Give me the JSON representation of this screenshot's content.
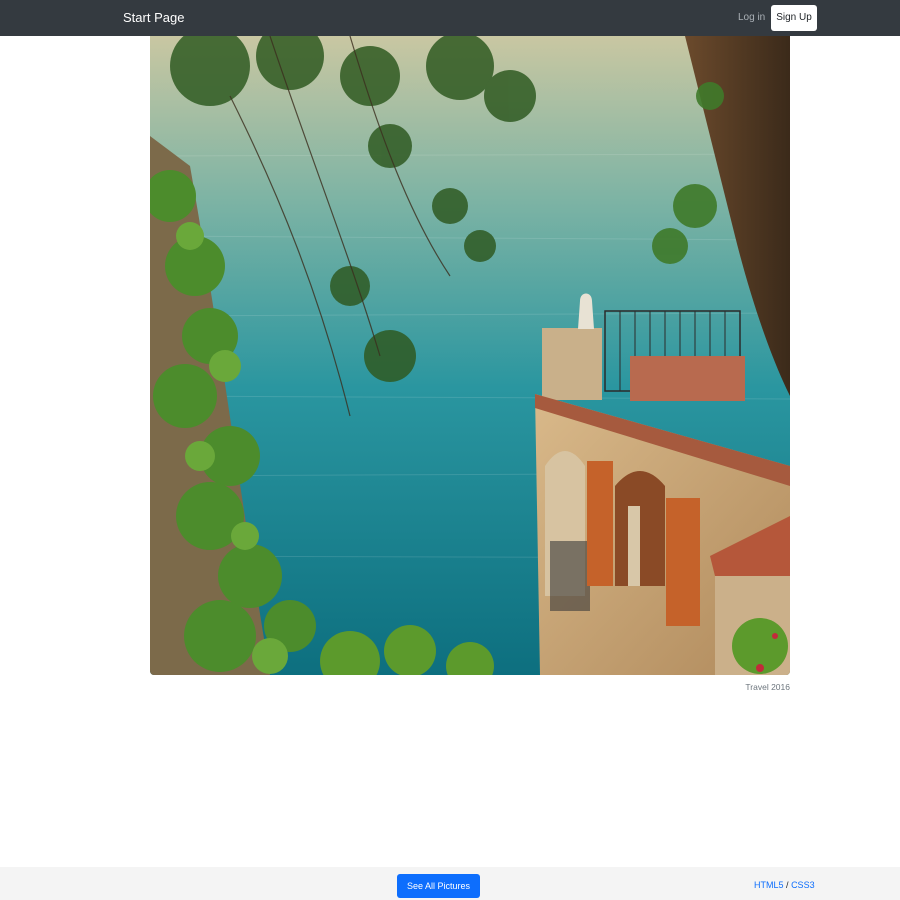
{
  "navbar": {
    "brand": "Start Page",
    "login_label": "Log in",
    "signup_label": "Sign Up",
    "background": "#343a40"
  },
  "photo": {
    "caption": "Travel 2016",
    "description_icon": "photo-seaside-villa"
  },
  "footer": {
    "see_all_label": "See All Pictures",
    "tech_html5": "HTML5",
    "tech_sep": "/",
    "tech_css3": "CSS3"
  },
  "colors": {
    "primary": "#0d6efd",
    "sea": "#1f8a94",
    "foliage": "#3f7a2a"
  }
}
